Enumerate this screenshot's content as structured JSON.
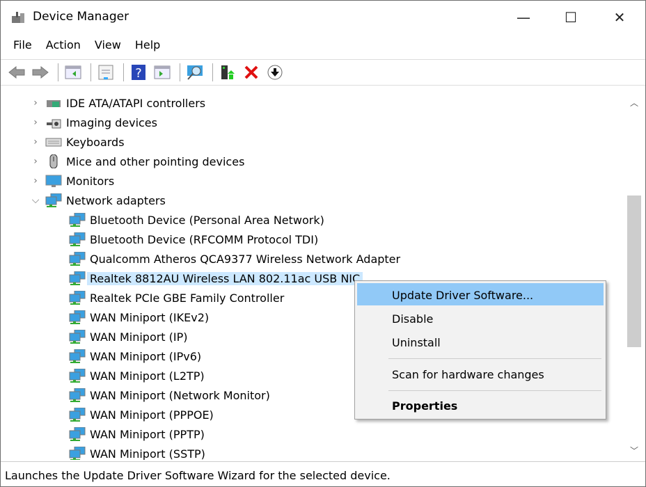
{
  "window": {
    "title": "Device Manager",
    "minimize": "—",
    "maximize": "☐",
    "close": "✕"
  },
  "menubar": [
    "File",
    "Action",
    "View",
    "Help"
  ],
  "toolbar": [
    "back-icon",
    "forward-icon",
    "show-hide-console-tree-icon",
    "properties-icon",
    "help-icon",
    "show-action-pane-icon",
    "scan-hardware-icon",
    "update-driver-icon",
    "uninstall-icon",
    "disable-icon"
  ],
  "tree": {
    "categories": [
      {
        "label": "IDE ATA/ATAPI controllers",
        "expanded": false
      },
      {
        "label": "Imaging devices",
        "expanded": false
      },
      {
        "label": "Keyboards",
        "expanded": false
      },
      {
        "label": "Mice and other pointing devices",
        "expanded": false
      },
      {
        "label": "Monitors",
        "expanded": false
      },
      {
        "label": "Network adapters",
        "expanded": true
      }
    ],
    "network_adapters": [
      "Bluetooth Device (Personal Area Network)",
      "Bluetooth Device (RFCOMM Protocol TDI)",
      "Qualcomm Atheros QCA9377 Wireless Network Adapter",
      "Realtek 8812AU Wireless LAN 802.11ac USB NIC",
      "Realtek PCIe GBE Family Controller",
      "WAN Miniport (IKEv2)",
      "WAN Miniport (IP)",
      "WAN Miniport (IPv6)",
      "WAN Miniport (L2TP)",
      "WAN Miniport (Network Monitor)",
      "WAN Miniport (PPPOE)",
      "WAN Miniport (PPTP)",
      "WAN Miniport (SSTP)"
    ],
    "selected": "Realtek 8812AU Wireless LAN 802.11ac USB NIC"
  },
  "context_menu": {
    "update": "Update Driver Software...",
    "disable": "Disable",
    "uninstall": "Uninstall",
    "scan": "Scan for hardware changes",
    "properties": "Properties"
  },
  "status": "Launches the Update Driver Software Wizard for the selected device.",
  "colors": {
    "selection": "#cce8ff",
    "menu_highlight": "#91c9f7"
  }
}
